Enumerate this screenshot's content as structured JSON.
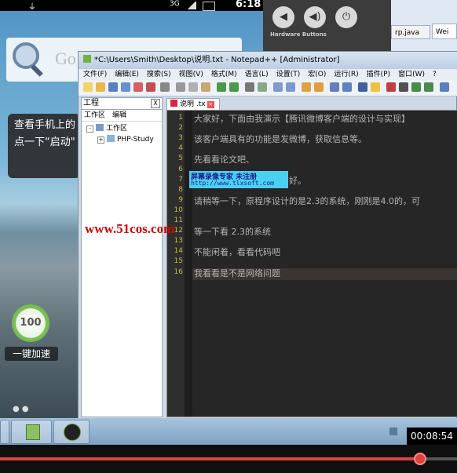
{
  "android": {
    "statusbar": {
      "signal": "3G",
      "time": "6:18",
      "usb_icon": "usb-icon"
    },
    "search_hint": "Go",
    "tip_lines": [
      "查看手机上的",
      "点一下“启动\""
    ],
    "accelerator": {
      "value": "100",
      "label": "一键加速"
    }
  },
  "hardware_panel": {
    "label": "Hardware Buttons"
  },
  "eclipse": {
    "tabs": [
      "rp.java",
      "Wei"
    ]
  },
  "notepad": {
    "title": "*C:\\Users\\Smith\\Desktop\\说明.txt - Notepad++ [Administrator]",
    "menu": [
      "文件(F)",
      "编辑(E)",
      "搜索(S)",
      "视图(V)",
      "格式(M)",
      "语言(L)",
      "设置(T)",
      "宏(O)",
      "运行(R)",
      "插件(P)",
      "窗口(W)",
      "?"
    ],
    "project_panel": {
      "title": "工程",
      "close": "X",
      "menu": [
        "工作区",
        "编辑"
      ],
      "tree": [
        {
          "expander": "-",
          "label": "工作区"
        },
        {
          "expander": "+",
          "label": "PHP-Study"
        }
      ]
    },
    "doc_tab": {
      "label": "说明 .tx"
    },
    "line_numbers": [
      "1",
      "2",
      "3",
      "4",
      "5",
      "6",
      "7",
      "8",
      "9",
      "10",
      "11",
      "12",
      "13",
      "14",
      "15",
      "16"
    ],
    "lines": [
      {
        "n": 1,
        "text": "大家好，下面由我演示【腾讯微博客户端的设计与实现】"
      },
      {
        "n": 3,
        "text": "该客户端具有的功能是发微博，获取信息等。"
      },
      {
        "n": 5,
        "text": "先看看论文吧、"
      },
      {
        "n": 7,
        "text": "开着迅雷，本身网速也不好。"
      },
      {
        "n": 9,
        "text": "请稍等一下，原程序设计的是2.3的系统，刚刚是4.0的，可"
      },
      {
        "n": 12,
        "text": "等一下看 2.3的系统"
      },
      {
        "n": 14,
        "text": "不能闲着，看看代码吧"
      },
      {
        "n": 16,
        "text": "我看看是不是网络问题"
      }
    ]
  },
  "watermark": {
    "title": "屏幕录像专家    未注册",
    "url": "http://www.tlxsoft.com"
  },
  "site_watermark": "www.51cos.com",
  "video": {
    "timestamp": "00:08:54",
    "progress": 0.92
  },
  "colors": {
    "accent": "#e0413a",
    "editor_bg": "#262626",
    "watermark_bg": "#4bd0f2"
  }
}
